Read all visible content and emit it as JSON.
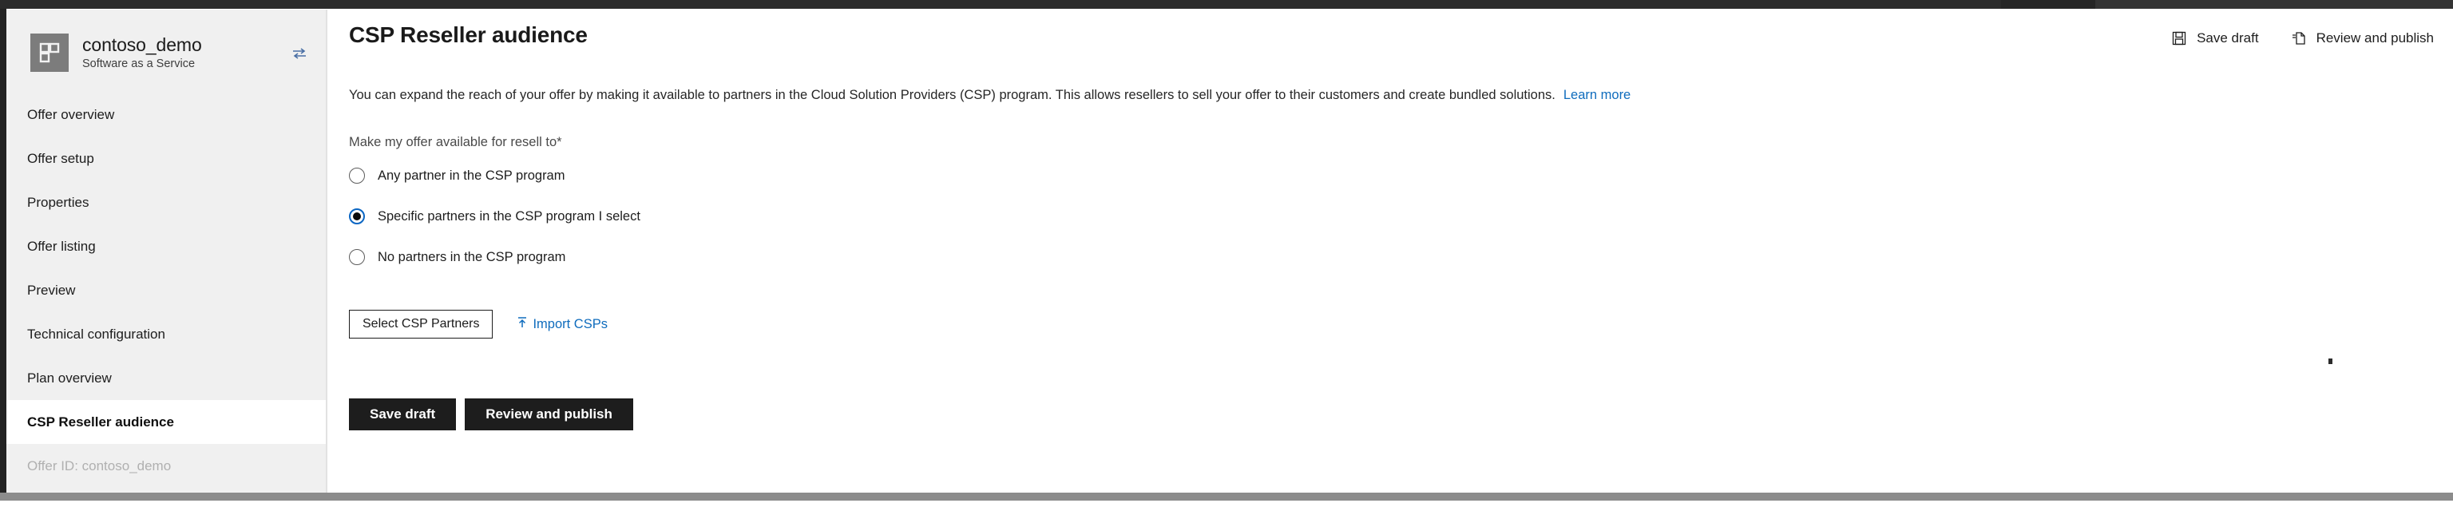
{
  "sidebar": {
    "brand": {
      "logo_icon": "grid-blocks-icon",
      "title": "contoso_demo",
      "subtitle": "Software as a Service",
      "swap_icon": "swap-arrows-icon"
    },
    "items": [
      {
        "label": "Offer overview",
        "selected": false,
        "muted": false
      },
      {
        "label": "Offer setup",
        "selected": false,
        "muted": false
      },
      {
        "label": "Properties",
        "selected": false,
        "muted": false
      },
      {
        "label": "Offer listing",
        "selected": false,
        "muted": false
      },
      {
        "label": "Preview",
        "selected": false,
        "muted": false
      },
      {
        "label": "Technical configuration",
        "selected": false,
        "muted": false
      },
      {
        "label": "Plan overview",
        "selected": false,
        "muted": false
      },
      {
        "label": "CSP Reseller audience",
        "selected": true,
        "muted": false
      },
      {
        "label": "Offer ID: contoso_demo",
        "selected": false,
        "muted": true
      }
    ]
  },
  "main": {
    "page_title": "CSP Reseller audience",
    "top_actions": [
      {
        "label": "Save draft",
        "icon": "save-floppy-icon"
      },
      {
        "label": "Review and publish",
        "icon": "publish-document-icon"
      }
    ],
    "description": {
      "text": "You can expand the reach of your offer by making it available to partners in the Cloud Solution Providers (CSP) program. This allows resellers to sell your offer to their customers and create bundled solutions.",
      "link_label": "Learn more"
    },
    "field_label": "Make my offer available for resell to*",
    "radio_options": [
      {
        "label": "Any partner in the CSP program",
        "checked": false
      },
      {
        "label": "Specific partners in the CSP program I select",
        "checked": true
      },
      {
        "label": "No partners in the CSP program",
        "checked": false
      }
    ],
    "select_partners_button": "Select CSP Partners",
    "import_link": {
      "label": "Import CSPs",
      "icon": "upload-arrow-icon"
    },
    "bottom_actions": [
      {
        "label": "Save draft"
      },
      {
        "label": "Review and publish"
      }
    ]
  },
  "colors": {
    "accent_link": "#0f6cbd",
    "radio_ring": "#0b66c3",
    "primary_button": "#1d1d1d",
    "sidebar_bg": "#f0f0f0"
  }
}
